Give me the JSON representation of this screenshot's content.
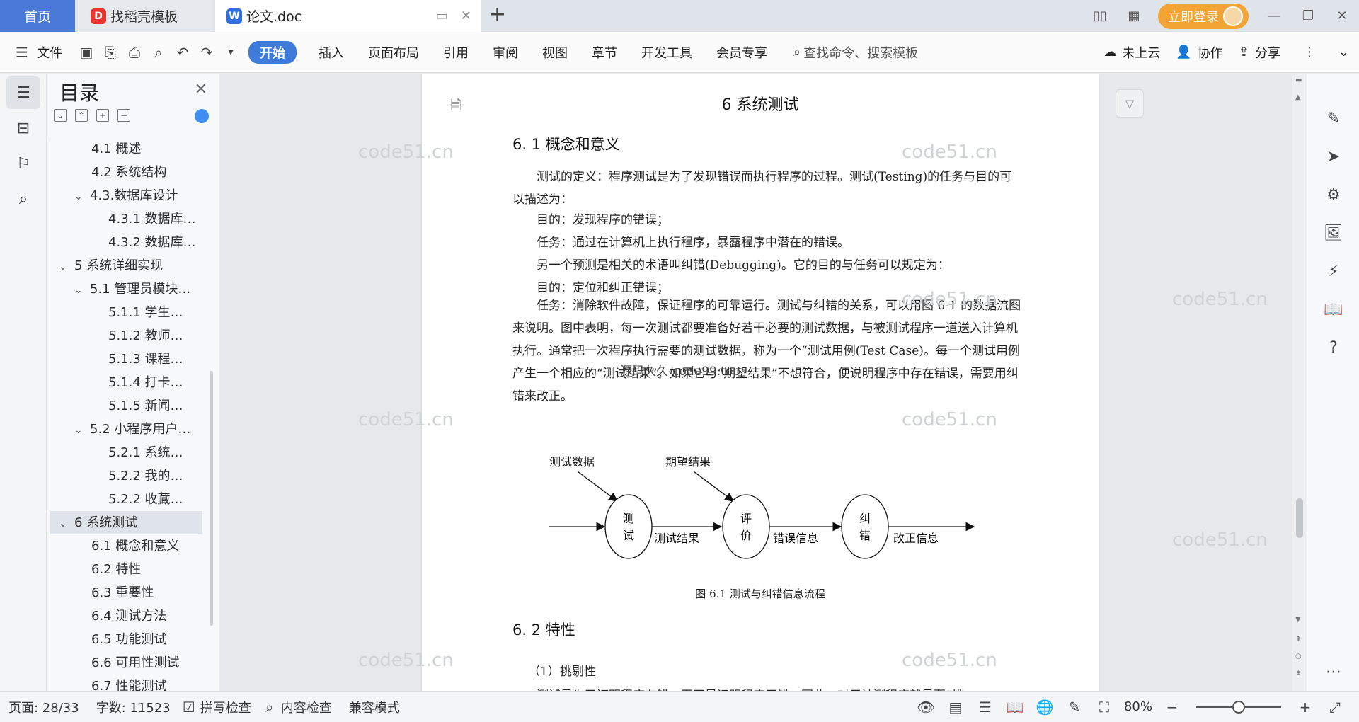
{
  "tabs": {
    "home": "首页",
    "daoke": "找稻壳模板",
    "doc": "论文.doc",
    "login": "立即登录"
  },
  "toolbar": {
    "file": "文件",
    "tabs": [
      "开始",
      "插入",
      "页面布局",
      "引用",
      "审阅",
      "视图",
      "章节",
      "开发工具",
      "会员专享"
    ],
    "search": "查找命令、搜索模板",
    "cloud": "未上云",
    "collab": "协作",
    "share": "分享"
  },
  "toc": {
    "title": "目录",
    "items": [
      {
        "label": "4.1 概述",
        "level": 2
      },
      {
        "label": "4.2 系统结构",
        "level": 2
      },
      {
        "label": "4.3.数据库设计",
        "level": 2,
        "expanded": true
      },
      {
        "label": "4.3.1 数据库…",
        "level": 3
      },
      {
        "label": "4.3.2 数据库…",
        "level": 3
      },
      {
        "label": "5 系统详细实现",
        "level": 1,
        "expanded": true
      },
      {
        "label": "5.1 管理员模块…",
        "level": 2,
        "expanded": true
      },
      {
        "label": "5.1.1 学生…",
        "level": 3
      },
      {
        "label": "5.1.2 教师…",
        "level": 3
      },
      {
        "label": "5.1.3 课程…",
        "level": 3
      },
      {
        "label": "5.1.4 打卡…",
        "level": 3
      },
      {
        "label": "5.1.5 新闻…",
        "level": 3
      },
      {
        "label": "5.2 小程序用户…",
        "level": 2,
        "expanded": true
      },
      {
        "label": "5.2.1 系统…",
        "level": 3
      },
      {
        "label": "5.2.2 我的…",
        "level": 3
      },
      {
        "label": "5.2.2 收藏…",
        "level": 3
      },
      {
        "label": "6 系统测试",
        "level": 1,
        "expanded": true,
        "selected": true
      },
      {
        "label": "6.1 概念和意义",
        "level": 2
      },
      {
        "label": "6.2 特性",
        "level": 2
      },
      {
        "label": "6.3 重要性",
        "level": 2
      },
      {
        "label": "6.4 测试方法",
        "level": 2
      },
      {
        "label": "6.5 功能测试",
        "level": 2
      },
      {
        "label": "6.6 可用性测试",
        "level": 2
      },
      {
        "label": "6.7 性能测试",
        "level": 2
      }
    ]
  },
  "document": {
    "chapter_title": "6 系统测试",
    "section1": "6. 1 概念和意义",
    "para1": "测试的定义：程序测试是为了发现错误而执行程序的过程。测试(Testing)的任务与目的可以描述为：",
    "line1": "目的：发现程序的错误；",
    "line2": "任务：通过在计算机上执行程序，暴露程序中潜在的错误。",
    "line3": "另一个预测是相关的术语叫纠错(Debugging)。它的目的与任务可以规定为：",
    "line4": "目的：定位和纠正错误；",
    "para2": "任务：消除软件故障，保证程序的可靠运行。测试与纠错的关系，可以用图 6-1 的数据流图来说明。图中表明，每一次测试都要准备好若干必要的测试数据，与被测试程序一道送入计算机执行。通常把一次程序执行需要的测试数据，称为一个“测试用例(Test Case)。每一个测试用例产生一个相应的“测试结果”。如果它与“期望结果”不想符合，便说明程序中存在错误，需要用纠错来改正。",
    "figure": {
      "test_data": "测试数据",
      "expected": "期望结果",
      "node1": [
        "测",
        "试"
      ],
      "node2": [
        "评",
        "价"
      ],
      "node3": [
        "纠",
        "错"
      ],
      "result": "测试结果",
      "error_info": "错误信息",
      "fix_info": "改正信息",
      "caption": "图 6.1 测试与纠错信息流程"
    },
    "section2": "6. 2 特性",
    "sub1": "（1）挑剔性",
    "partial": "测试是为了证明程序有错，而不是证明程序无错。因此，对于被测程序就是要“挑"
  },
  "watermarks": {
    "main": "code51.cn",
    "center": "源码久久-code99.top"
  },
  "status": {
    "page": "页面: 28/33",
    "words": "字数: 11523",
    "spell": "拼写检查",
    "content": "内容检查",
    "compat": "兼容模式",
    "zoom": "80%",
    "zoom_level": 0.5
  }
}
